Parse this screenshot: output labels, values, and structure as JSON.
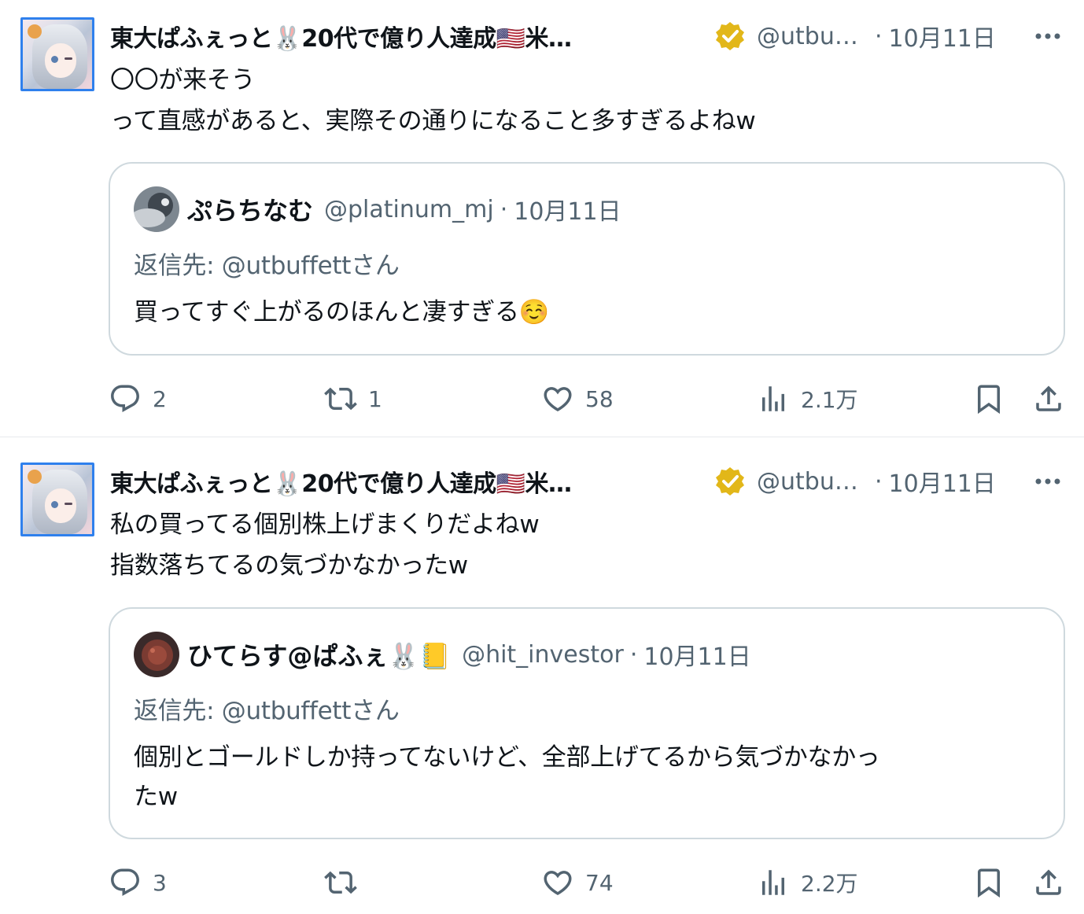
{
  "tweets": [
    {
      "author": {
        "display_name": "東大ぱふぇっと🐰20代で億り人達成🇺🇸米…",
        "handle": "@utbu…",
        "date": "10月11日"
      },
      "text_lines": [
        "〇〇が来そう",
        "って直感があると、実際その通りになること多すぎるよねw"
      ],
      "quote": {
        "display_name": "ぷらちなむ",
        "handle": "@platinum_mj",
        "date": "10月11日",
        "reply_to": "返信先: @utbuffettさん",
        "text": "買ってすぐ上がるのほんと凄すぎる☺️"
      },
      "stats": {
        "replies": "2",
        "retweets": "1",
        "likes": "58",
        "views": "2.1万"
      }
    },
    {
      "author": {
        "display_name": "東大ぱふぇっと🐰20代で億り人達成🇺🇸米…",
        "handle": "@utbu…",
        "date": "10月11日"
      },
      "text_lines": [
        "私の買ってる個別株上げまくりだよねw",
        "指数落ちてるの気づかなかったw"
      ],
      "quote": {
        "display_name": "ひてらす@ぱふぇ🐰📒",
        "handle": "@hit_investor",
        "date": "10月11日",
        "reply_to": "返信先: @utbuffettさん",
        "text_lines": [
          "個別とゴールドしか持ってないけど、全部上げてるから気づかなかっ",
          "たw"
        ]
      },
      "stats": {
        "replies": "3",
        "retweets": "",
        "likes": "74",
        "views": "2.2万"
      }
    }
  ],
  "icons": {
    "verified": "verified-badge-icon",
    "more": "more-icon",
    "reply": "reply-icon",
    "retweet": "retweet-icon",
    "like": "heart-icon",
    "views": "views-icon",
    "bookmark": "bookmark-icon",
    "share": "share-icon"
  },
  "colors": {
    "secondary_text": "#536471",
    "border": "#cfd9de",
    "verified_gold": "#e2b719"
  }
}
